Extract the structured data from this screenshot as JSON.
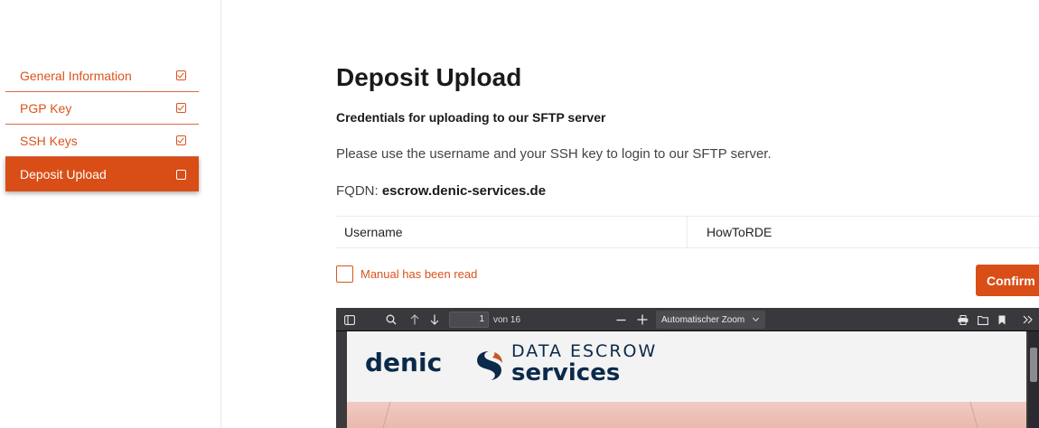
{
  "sidebar": {
    "items": [
      {
        "label": "General Information",
        "completed": true,
        "active": false
      },
      {
        "label": "PGP Key",
        "completed": true,
        "active": false
      },
      {
        "label": "SSH Keys",
        "completed": true,
        "active": false
      },
      {
        "label": "Deposit Upload",
        "completed": false,
        "active": true
      }
    ]
  },
  "main": {
    "title": "Deposit Upload",
    "subtitle": "Credentials for uploading to our SFTP server",
    "description": "Please use the username and your SSH key to login to our SFTP server.",
    "fqdn_label": "FQDN: ",
    "fqdn_value": "escrow.denic-services.de",
    "credentials": {
      "key": "Username",
      "value": "HowToRDE"
    },
    "manual_checkbox_label": "Manual has been read",
    "confirm_label": "Confirm"
  },
  "pdf_viewer": {
    "current_page": "1",
    "page_total": "von 16",
    "zoom": "Automatischer Zoom",
    "document": {
      "brand": "denic",
      "tagline_top": "DATA ESCROW",
      "tagline_bottom": "services"
    }
  },
  "colors": {
    "accent": "#d94e16",
    "brand_navy": "#0b2a4a",
    "viewer_bg": "#38383d"
  },
  "icons": {
    "sidebar_toggle": "sidebar-toggle-icon",
    "search": "search-icon",
    "prev_page": "arrow-up-icon",
    "next_page": "arrow-down-icon",
    "zoom_out": "minus-icon",
    "zoom_in": "plus-icon",
    "print": "print-icon",
    "open_file": "folder-icon",
    "bookmark": "bookmark-icon",
    "more_tools": "double-chevron-right-icon"
  }
}
